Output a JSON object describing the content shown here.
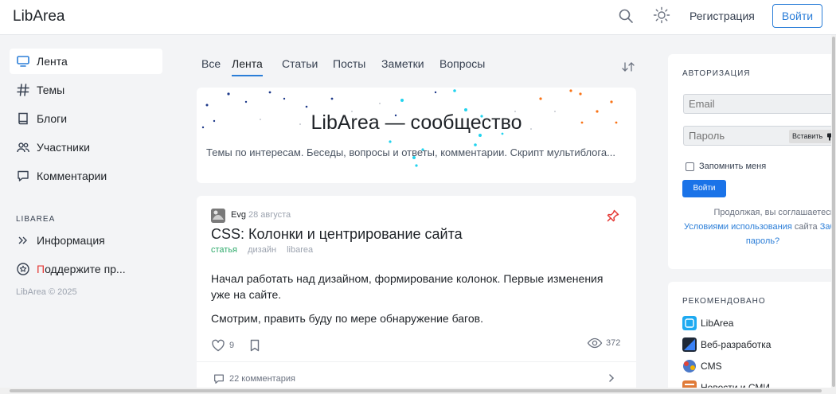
{
  "header": {
    "logo": "LibArea",
    "register_label": "Регистрация",
    "login_label": "Войти"
  },
  "sidebar": {
    "items": [
      {
        "label": "Лента",
        "icon": "monitor-icon"
      },
      {
        "label": "Темы",
        "icon": "hash-icon"
      },
      {
        "label": "Блоги",
        "icon": "book-icon"
      },
      {
        "label": "Участники",
        "icon": "users-icon"
      },
      {
        "label": "Комментарии",
        "icon": "comment-icon"
      }
    ],
    "section_title": "LIBAREA",
    "info_label": "Информация",
    "support_first": "П",
    "support_rest": "оддержите пр...",
    "copyright": "LibArea © 2025"
  },
  "tabs": [
    "Все",
    "Лента",
    "Статьи",
    "Посты",
    "Заметки",
    "Вопросы"
  ],
  "hero": {
    "title": "LibArea — сообщество",
    "subtitle": "Темы по интересам. Беседы, вопросы и ответы, комментарии. Скрипт мультиблога..."
  },
  "post": {
    "author": "Evg",
    "date": "28 августа",
    "title": "CSS: Колонки и центрирование сайта",
    "tag_type": "статья",
    "tags": [
      "дизайн",
      "libarea"
    ],
    "paragraph1": "Начал работать над дизайном, формирование колонок. Первые изменения уже на сайте.",
    "paragraph2": "Смотрим, править буду по мере обнаружение багов.",
    "likes": "9",
    "views": "372",
    "comments": "22 комментария"
  },
  "auth": {
    "title": "АВТОРИЗАЦИЯ",
    "email_placeholder": "Email",
    "password_placeholder": "Пароль",
    "paste_label": "Вставить",
    "remember_label": "Запомнить меня",
    "submit_label": "Войти",
    "terms_prefix": "Продолжая, вы соглашаетесь с",
    "terms_link": "Условиями использования",
    "terms_mid": " сайта ",
    "terms_link2": "Заб",
    "terms_end": "пароль?"
  },
  "recommended": {
    "title": "РЕКОМЕНДОВАНО",
    "items": [
      "LibArea",
      "Веб-разработка",
      "CMS",
      "Новости и СМИ"
    ]
  },
  "colors": {
    "accent": "#2b7ed8",
    "button": "#1a73e8",
    "tag_type": "#2eaa6b",
    "pin": "#e53935"
  }
}
